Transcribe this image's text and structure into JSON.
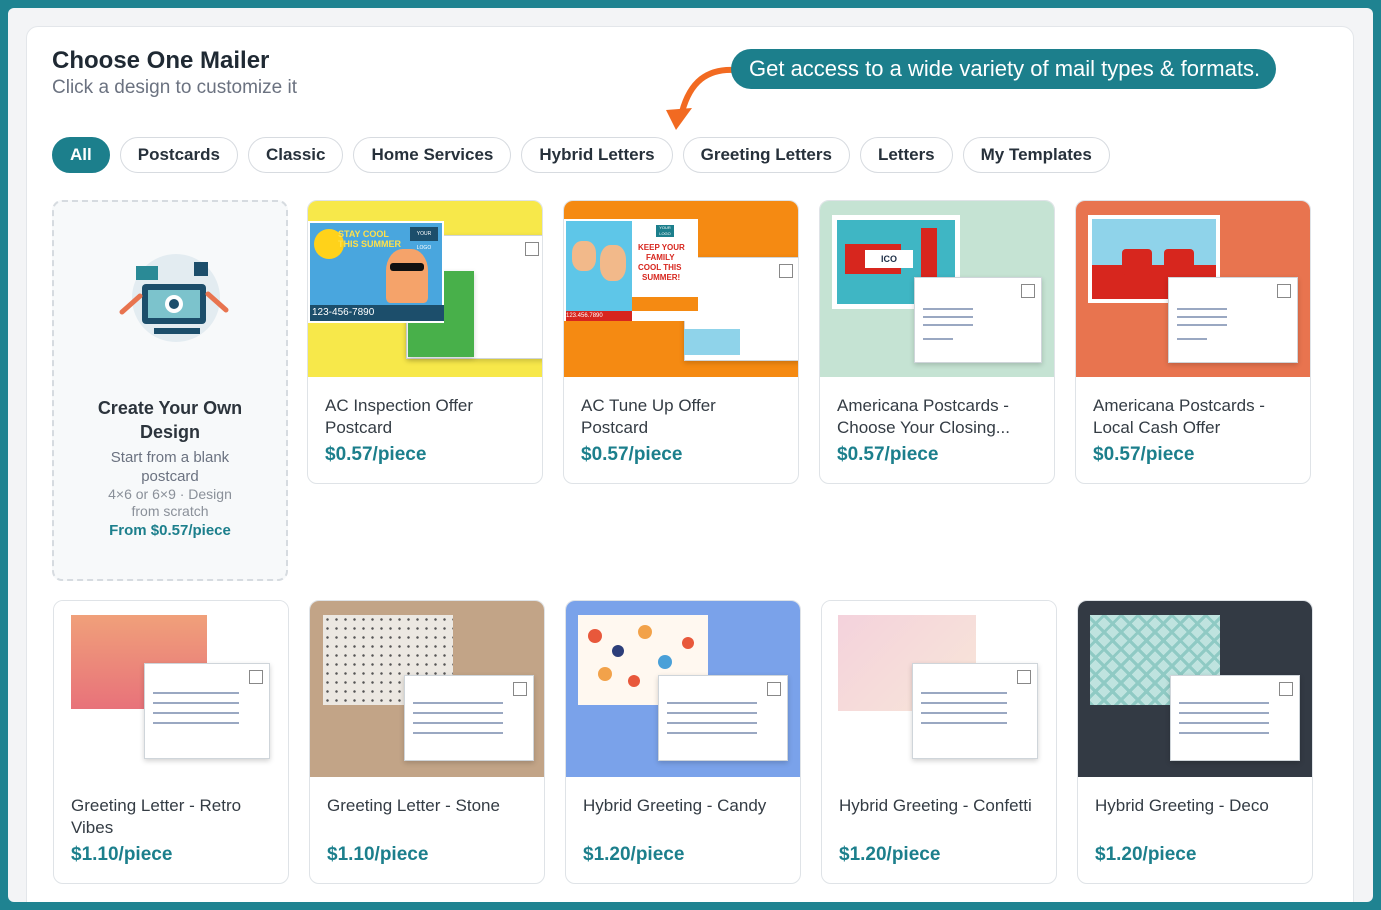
{
  "header": {
    "title": "Choose One Mailer",
    "subtitle": "Click a design to customize it"
  },
  "callout": {
    "text": "Get access to a wide variety of mail types & formats."
  },
  "tabs": [
    {
      "label": "All",
      "active": true
    },
    {
      "label": "Postcards"
    },
    {
      "label": "Classic"
    },
    {
      "label": "Home Services"
    },
    {
      "label": "Hybrid Letters"
    },
    {
      "label": "Greeting Letters"
    },
    {
      "label": "Letters"
    },
    {
      "label": "My Templates"
    }
  ],
  "create": {
    "title": "Create Your Own Design",
    "subtitle": "Start from a blank postcard",
    "detail": "4×6 or 6×9 · Design from scratch",
    "price": "From $0.57/piece"
  },
  "cards": [
    {
      "name": "AC Inspection Offer Postcard",
      "price": "$0.57/piece",
      "bg": "#f7e84a",
      "front_text": [
        "STAY COOL",
        "THIS SUMMER"
      ],
      "phone": "123-456-7890",
      "logo": "YOUR LOGO"
    },
    {
      "name": "AC Tune Up Offer Postcard",
      "price": "$0.57/piece",
      "bg": "#f58a12",
      "front_text": [
        "KEEP YOUR",
        "FAMILY",
        "COOL THIS",
        "SUMMER!"
      ],
      "phone": "123.456.7890",
      "logo": "YOUR LOGO"
    },
    {
      "name": "Americana Postcards - Choose Your Closing...",
      "price": "$0.57/piece",
      "bg": "#c5e3d3"
    },
    {
      "name": "Americana Postcards - Local Cash Offer",
      "price": "$0.57/piece",
      "bg": "#e8744f"
    },
    {
      "name": "Greeting Letter - Retro Vibes",
      "price": "$1.10/piece",
      "bg": "#ffffff"
    },
    {
      "name": "Greeting Letter - Stone",
      "price": "$1.10/piece",
      "bg": "#c2a487"
    },
    {
      "name": "Hybrid Greeting - Candy",
      "price": "$1.20/piece",
      "bg": "#7aa2ea"
    },
    {
      "name": "Hybrid Greeting - Confetti",
      "price": "$1.20/piece",
      "bg": "#ffffff"
    },
    {
      "name": "Hybrid Greeting - Deco",
      "price": "$1.20/piece",
      "bg": "#333a44"
    }
  ]
}
